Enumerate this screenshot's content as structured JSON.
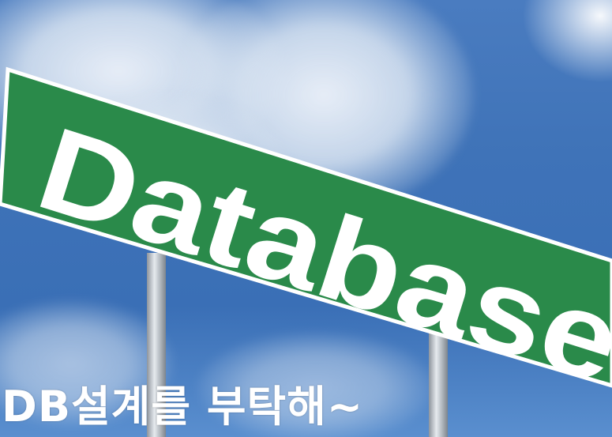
{
  "sign": {
    "text": "Database",
    "color": "#2a8a4a",
    "border_color": "#ffffff"
  },
  "caption": {
    "text": "DB설계를 부탁해~"
  },
  "colors": {
    "sky": "#3f73b8",
    "cloud": "#eef2f8",
    "pole": "#c3c9cf"
  }
}
